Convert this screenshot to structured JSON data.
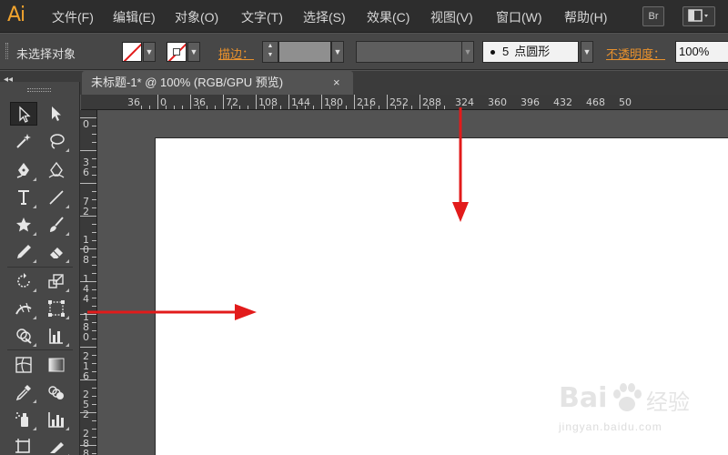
{
  "menubar": {
    "logo": "Ai",
    "items": [
      "文件(F)",
      "编辑(E)",
      "对象(O)",
      "文字(T)",
      "选择(S)",
      "效果(C)",
      "视图(V)",
      "窗口(W)",
      "帮助(H)"
    ],
    "bridge_label": "Br",
    "workspace_icon": "workspace-layout-icon"
  },
  "controlbar": {
    "selection_status": "未选择对象",
    "stroke_label": "描边：",
    "brush_size": "5",
    "brush_type": "点圆形",
    "opacity_label": "不透明度：",
    "opacity_value": "100%"
  },
  "document": {
    "tab_title": "未标题-1* @ 100% (RGB/GPU 预览)",
    "close_symbol": "×",
    "collapse_symbol": "◂◂"
  },
  "rulers": {
    "horizontal": [
      "36",
      "0",
      "36",
      "72",
      "108",
      "144",
      "180",
      "216",
      "252",
      "288",
      "324",
      "360",
      "396",
      "432",
      "468",
      "50"
    ],
    "vertical": [
      [
        "0"
      ],
      [
        "3",
        "6"
      ],
      [
        "7",
        "2"
      ],
      [
        "1",
        "0",
        "8"
      ],
      [
        "1",
        "4",
        "4"
      ],
      [
        "1",
        "8",
        "0"
      ],
      [
        "2",
        "1",
        "6"
      ],
      [
        "2",
        "5",
        "2"
      ],
      [
        "2",
        "8",
        "8"
      ]
    ]
  },
  "tools": [
    {
      "name": "selection-tool",
      "active": true
    },
    {
      "name": "direct-selection-tool"
    },
    {
      "name": "magic-wand-tool"
    },
    {
      "name": "lasso-tool"
    },
    {
      "name": "pen-tool"
    },
    {
      "name": "curvature-tool"
    },
    {
      "name": "type-tool",
      "glyph": "T"
    },
    {
      "name": "line-segment-tool"
    },
    {
      "name": "star-tool"
    },
    {
      "name": "paintbrush-tool"
    },
    {
      "name": "pencil-tool"
    },
    {
      "name": "eraser-tool"
    },
    {
      "name": "rotate-tool"
    },
    {
      "name": "scale-tool"
    },
    {
      "name": "width-tool"
    },
    {
      "name": "free-transform-tool"
    },
    {
      "name": "shape-builder-tool"
    },
    {
      "name": "perspective-grid-tool"
    },
    {
      "name": "mesh-tool"
    },
    {
      "name": "gradient-tool"
    },
    {
      "name": "eyedropper-tool"
    },
    {
      "name": "blend-tool"
    },
    {
      "name": "symbol-sprayer-tool"
    },
    {
      "name": "column-graph-tool"
    },
    {
      "name": "artboard-tool"
    },
    {
      "name": "slice-tool"
    }
  ],
  "watermark": {
    "logo_text": "Bai",
    "logo_suffix": "经验",
    "url": "jingyan.baidu.com"
  },
  "colors": {
    "accent": "#e8912d",
    "arrow": "#e21b1b",
    "menubar_bg": "#2d2d2d",
    "panel_bg": "#474747",
    "canvas_bg": "#535353"
  }
}
